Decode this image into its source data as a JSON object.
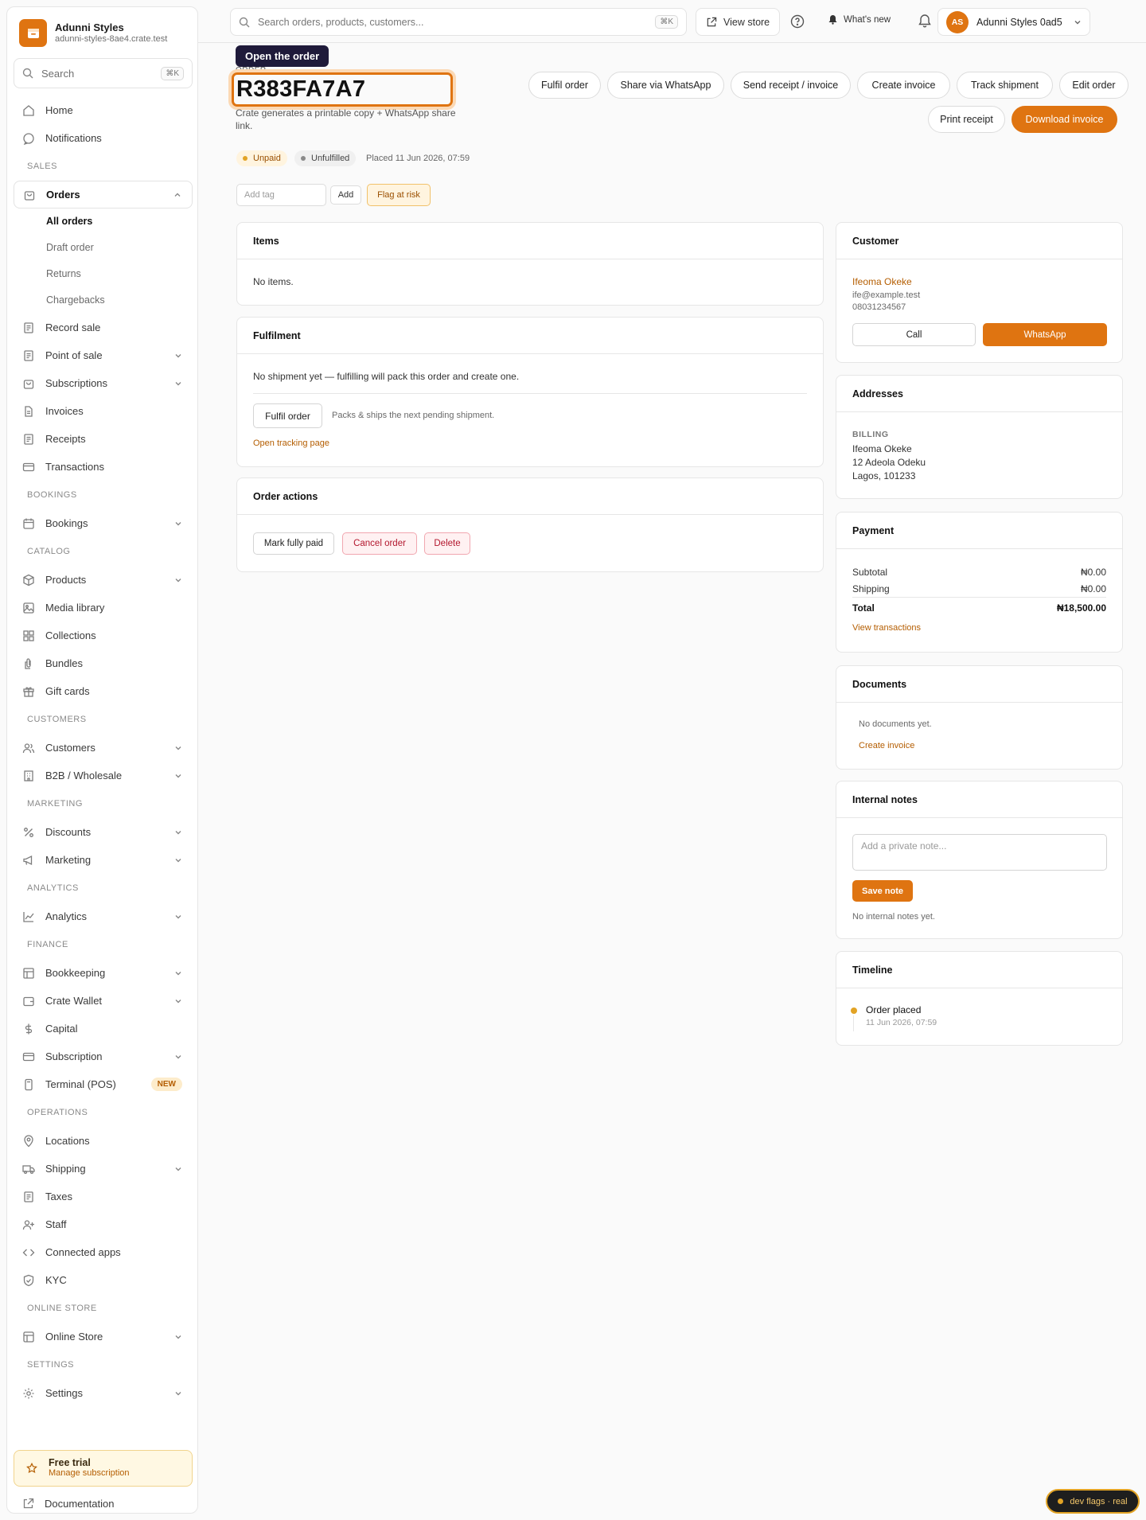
{
  "brand": {
    "name": "Adunni Styles",
    "url": "adunni-styles-8ae4.crate.test"
  },
  "side_search": {
    "label": "Search",
    "shortcut": "⌘K"
  },
  "nav": {
    "home": "Home",
    "notifications": "Notifications",
    "sales": "SALES",
    "orders": "Orders",
    "orders_sub": [
      "All orders",
      "Draft order",
      "Returns",
      "Chargebacks"
    ],
    "record_sale": "Record sale",
    "pos": "Point of sale",
    "subscriptions": "Subscriptions",
    "invoices": "Invoices",
    "receipts": "Receipts",
    "transactions": "Transactions",
    "bookings_sec": "BOOKINGS",
    "bookings": "Bookings",
    "catalog": "CATALOG",
    "products": "Products",
    "media": "Media library",
    "collections": "Collections",
    "bundles": "Bundles",
    "gift_cards": "Gift cards",
    "customers_sec": "CUSTOMERS",
    "customers": "Customers",
    "b2b": "B2B / Wholesale",
    "marketing_sec": "MARKETING",
    "discounts": "Discounts",
    "marketing": "Marketing",
    "analytics_sec": "ANALYTICS",
    "analytics": "Analytics",
    "finance_sec": "FINANCE",
    "bookkeeping": "Bookkeeping",
    "wallet": "Crate Wallet",
    "capital": "Capital",
    "subscription": "Subscription",
    "terminal": "Terminal (POS)",
    "new_badge": "NEW",
    "operations_sec": "OPERATIONS",
    "locations": "Locations",
    "shipping": "Shipping",
    "taxes": "Taxes",
    "staff": "Staff",
    "apps": "Connected apps",
    "kyc": "KYC",
    "online_sec": "ONLINE STORE",
    "online_store": "Online Store",
    "settings_sec": "SETTINGS",
    "settings": "Settings"
  },
  "trial": {
    "title": "Free trial",
    "link": "Manage subscription"
  },
  "docs": "Documentation",
  "topbar": {
    "search_placeholder": "Search orders, products, customers...",
    "shortcut": "⌘K",
    "view_store": "View store",
    "whats_new": "What's new",
    "account": "Adunni Styles 0ad5",
    "avatar": "AS"
  },
  "tooltip": "Open the order",
  "order": {
    "label": "ORDER",
    "id": "R383FA7A7",
    "help": "Crate generates a printable copy + WhatsApp share link.",
    "status_payment": "Unpaid",
    "status_fulfil": "Unfulfilled",
    "placed": "Placed 11 Jun 2026, 07:59"
  },
  "actions": {
    "fulfil": "Fulfil order",
    "share": "Share via WhatsApp",
    "send": "Send receipt / invoice",
    "create_invoice": "Create invoice",
    "track": "Track shipment",
    "edit": "Edit order",
    "print": "Print receipt",
    "download": "Download invoice"
  },
  "tags": {
    "placeholder": "Add tag",
    "add": "Add",
    "flag": "Flag at risk"
  },
  "items": {
    "title": "Items",
    "empty": "No items."
  },
  "fulfilment": {
    "title": "Fulfilment",
    "empty": "No shipment yet — fulfilling will pack this order and create one.",
    "button": "Fulfil order",
    "hint": "Packs & ships the next pending shipment.",
    "tracking": "Open tracking page"
  },
  "order_actions": {
    "title": "Order actions",
    "paid": "Mark fully paid",
    "cancel": "Cancel order",
    "delete": "Delete"
  },
  "customer": {
    "title": "Customer",
    "name": "Ifeoma Okeke",
    "email": "ife@example.test",
    "phone": "08031234567",
    "call": "Call",
    "whatsapp": "WhatsApp"
  },
  "addresses": {
    "title": "Addresses",
    "billing_label": "BILLING",
    "name": "Ifeoma Okeke",
    "line1": "12 Adeola Odeku",
    "line2": "Lagos, 101233"
  },
  "payment": {
    "title": "Payment",
    "subtotal_label": "Subtotal",
    "subtotal": "₦0.00",
    "shipping_label": "Shipping",
    "shipping": "₦0.00",
    "total_label": "Total",
    "total": "₦18,500.00",
    "link": "View transactions"
  },
  "documents": {
    "title": "Documents",
    "empty": "No documents yet.",
    "link": "Create invoice"
  },
  "notes": {
    "title": "Internal notes",
    "placeholder": "Add a private note...",
    "save": "Save note",
    "empty": "No internal notes yet."
  },
  "timeline": {
    "title": "Timeline",
    "event": "Order placed",
    "time": "11 Jun 2026, 07:59"
  },
  "devflags": "dev flags · real",
  "colors": {
    "accent": "#df7411",
    "unpaid": "#e2a325",
    "danger": "#b3172e"
  }
}
